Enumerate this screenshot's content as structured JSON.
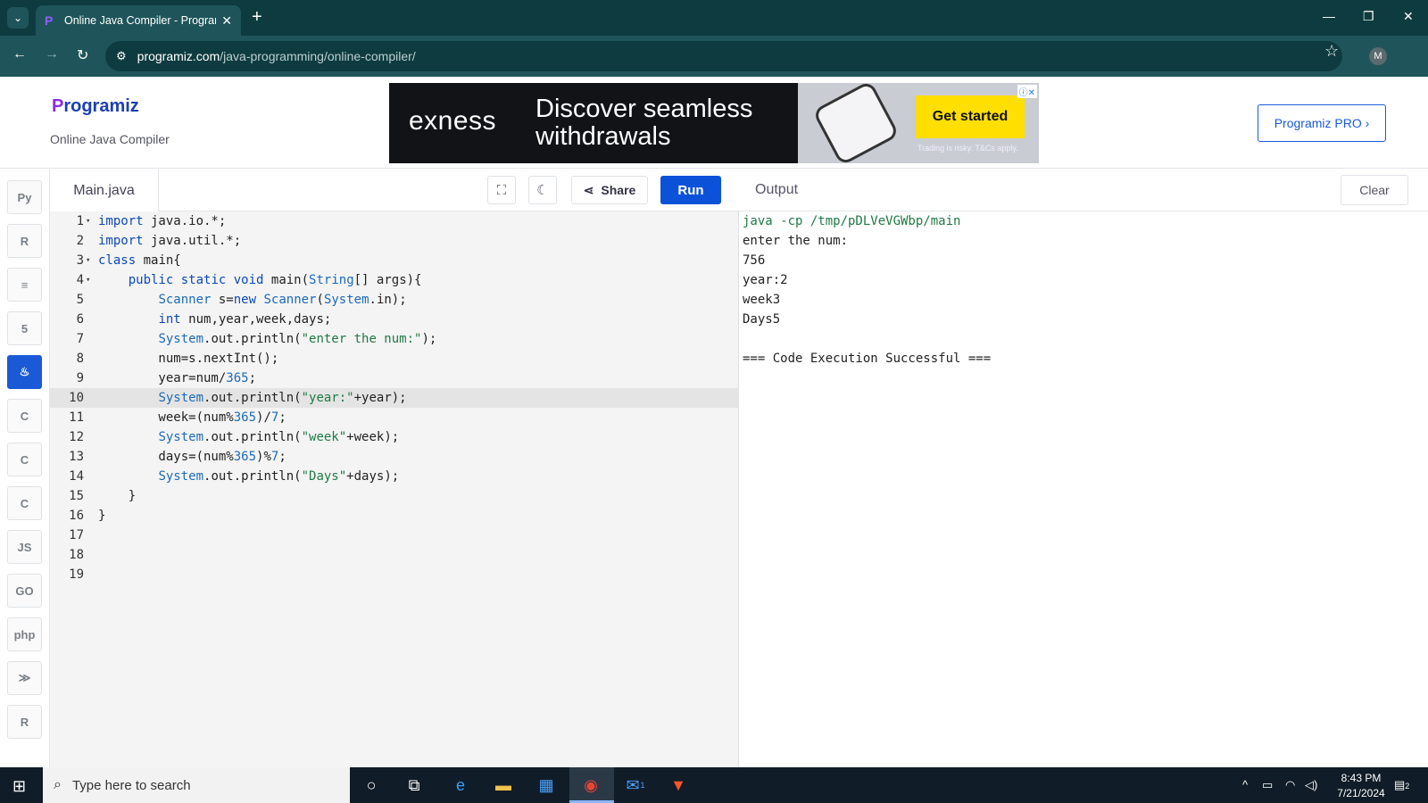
{
  "browser": {
    "tab_title": "Online Java Compiler - Program",
    "url_host": "programiz.com",
    "url_path": "/java-programming/online-compiler/",
    "profile_initial": "M"
  },
  "site": {
    "logo_text": "rogramiz",
    "logo_initial": "P",
    "subtitle": "Online Java Compiler",
    "pro_button": "Programiz PRO ›"
  },
  "ad": {
    "brand": "exness",
    "headline_1": "Discover seamless",
    "headline_2": "withdrawals",
    "cta": "Get started",
    "disclaimer": "Trading is risky. T&Cs apply."
  },
  "sidebar": {
    "items": [
      {
        "name": "python",
        "label": "Py"
      },
      {
        "name": "r",
        "label": "R"
      },
      {
        "name": "sql",
        "label": "≡"
      },
      {
        "name": "html",
        "label": "5"
      },
      {
        "name": "java",
        "label": "♨"
      },
      {
        "name": "c",
        "label": "C"
      },
      {
        "name": "cpp",
        "label": "C"
      },
      {
        "name": "csharp",
        "label": "C"
      },
      {
        "name": "js",
        "label": "JS"
      },
      {
        "name": "go",
        "label": "GO"
      },
      {
        "name": "php",
        "label": "php"
      },
      {
        "name": "swift",
        "label": "≫"
      },
      {
        "name": "rust",
        "label": "R"
      }
    ]
  },
  "editor": {
    "filename": "Main.java",
    "share_label": "Share",
    "run_label": "Run",
    "highlighted_line": 10,
    "lines": [
      "import java.io.*;",
      "import java.util.*;",
      "class main{",
      "    public static void main(String[] args){",
      "        Scanner s=new Scanner(System.in);",
      "        int num,year,week,days;",
      "        System.out.println(\"enter the num:\");",
      "        num=s.nextInt();",
      "        year=num/365;",
      "        System.out.println(\"year:\"+year);",
      "        week=(num%365)/7;",
      "        System.out.println(\"week\"+week);",
      "        days=(num%365)%7;",
      "        System.out.println(\"Days\"+days);",
      "    }",
      "}",
      "",
      "",
      ""
    ]
  },
  "output": {
    "label": "Output",
    "clear_label": "Clear",
    "lines": [
      "java -cp /tmp/pDLVeVGWbp/main",
      "enter the num:",
      "756",
      "year:2",
      "week3",
      "Days5",
      "",
      "=== Code Execution Successful ==="
    ]
  },
  "taskbar": {
    "search_placeholder": "Type here to search",
    "time": "8:43 PM",
    "date": "7/21/2024",
    "mail_badge": "1",
    "notif_badge": "2"
  }
}
